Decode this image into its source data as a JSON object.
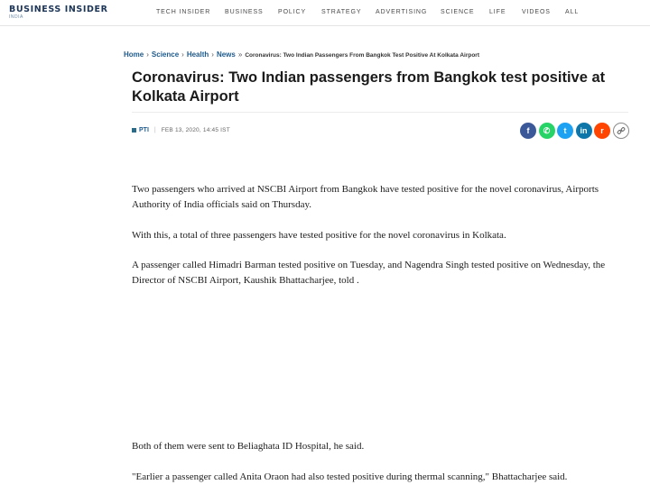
{
  "header": {
    "logo_main": "BUSINESS INSIDER",
    "logo_sub": "INDIA",
    "nav": [
      "TECH INSIDER",
      "BUSINESS",
      "POLICY",
      "STRATEGY",
      "ADVERTISING",
      "SCIENCE",
      "LIFE",
      "VIDEOS",
      "ALL"
    ]
  },
  "breadcrumb": {
    "items": [
      "Home",
      "Science",
      "Health",
      "News"
    ],
    "separator": "›",
    "last_separator": "»",
    "current": "Coronavirus: Two Indian Passengers From Bangkok Test Positive At Kolkata Airport"
  },
  "article": {
    "title": "Coronavirus: Two Indian passengers from Bangkok test positive at Kolkata Airport",
    "author": "PTI",
    "date": "FEB 13, 2020, 14:45 IST",
    "share": {
      "icons": [
        "facebook-icon",
        "whatsapp-icon",
        "twitter-icon",
        "linkedin-icon",
        "reddit-icon",
        "link-icon"
      ],
      "glyphs": [
        "f",
        "✆",
        "t",
        "in",
        "r",
        "🔗"
      ]
    },
    "paragraphs": [
      "Two passengers who arrived at NSCBI Airport from Bangkok have tested positive for the novel coronavirus, Airports Authority of India officials said on Thursday.",
      "With this, a total of three passengers have tested positive for the novel coronavirus in Kolkata.",
      "A passenger called Himadri Barman tested positive on Tuesday, and Nagendra Singh tested positive on Wednesday, the Director of NSCBI Airport, Kaushik Bhattacharjee, told .",
      "Both of them were sent to Beliaghata ID Hospital, he said.",
      "\"Earlier a passenger called Anita Oraon had also tested positive during thermal scanning,\" Bhattacharjee said."
    ]
  }
}
